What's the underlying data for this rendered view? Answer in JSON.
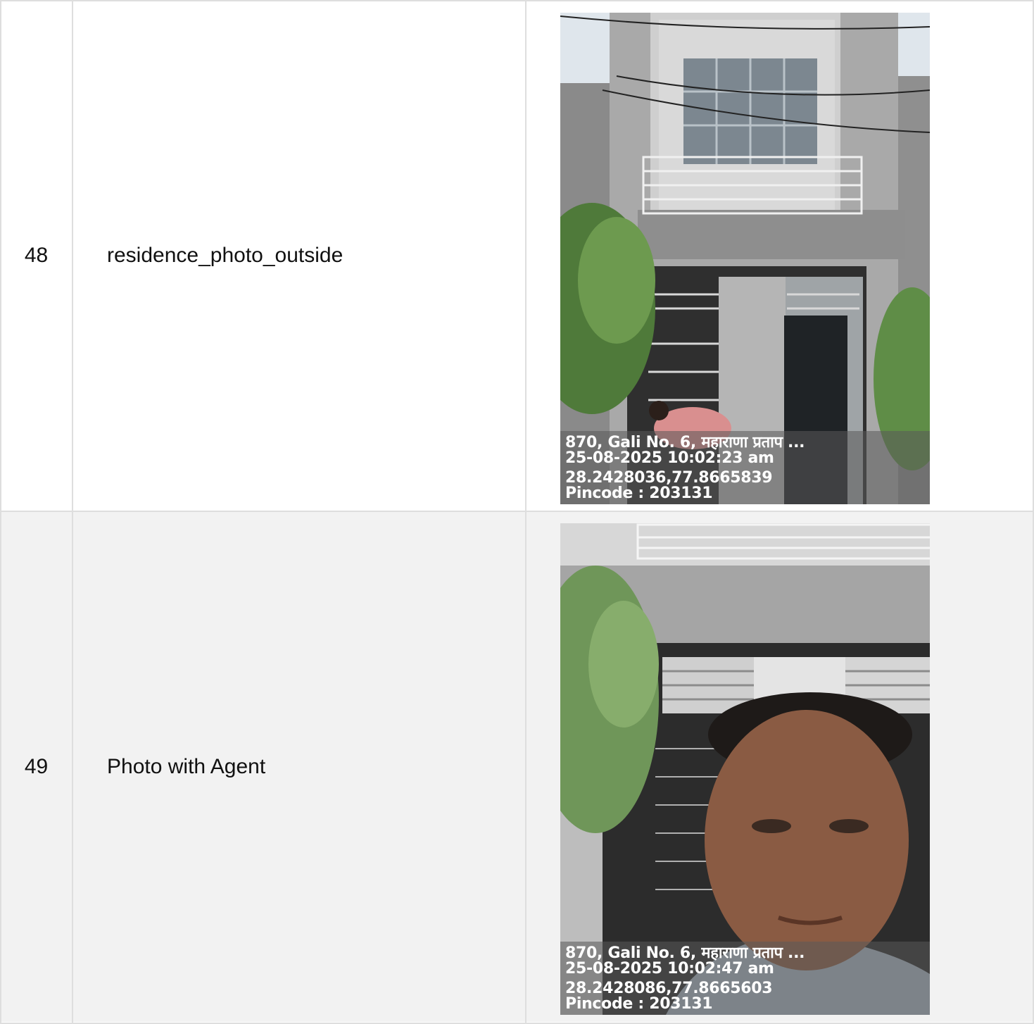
{
  "rows": [
    {
      "number": "48",
      "label": "residence_photo_outside",
      "photo": {
        "subject": "house-front-photo",
        "stamp": {
          "address": "870, Gali No. 6, महाराणा प्रताप ...",
          "datetime": "25-08-2025 10:02:23 am",
          "coordinates": "28.2428036,77.8665839",
          "pincode": "Pincode : 203131"
        }
      }
    },
    {
      "number": "49",
      "label": "Photo with Agent",
      "photo": {
        "subject": "agent-selfie-photo",
        "stamp": {
          "address": "870, Gali No. 6, महाराणा प्रताप ...",
          "datetime": "25-08-2025 10:02:47 am",
          "coordinates": "28.2428086,77.8665603",
          "pincode": "Pincode : 203131"
        }
      }
    }
  ],
  "colors": {
    "border": "#dedede",
    "alt_row": "#f2f2f2",
    "text": "#111111"
  }
}
